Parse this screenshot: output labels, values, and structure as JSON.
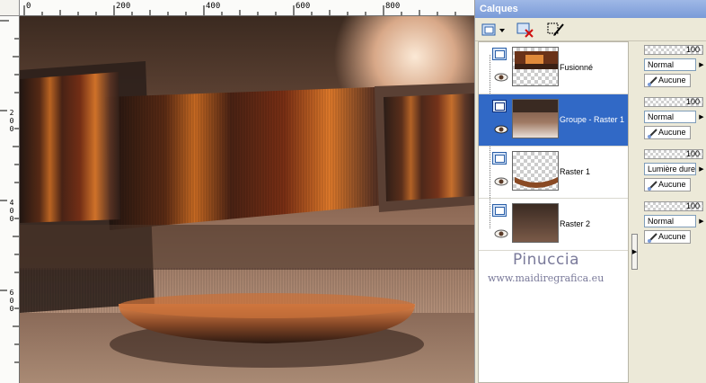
{
  "canvas": {
    "ruler_top_labels": [
      "0",
      "200",
      "400",
      "600",
      "800"
    ],
    "ruler_left_labels": [
      "2",
      "0",
      "0",
      "4",
      "0",
      "0",
      "6",
      "0",
      "0"
    ]
  },
  "layers_panel": {
    "title": "Calques",
    "layers": [
      {
        "name": "Fusionné",
        "selected": false,
        "opacity": "100",
        "blend_mode": "Normal",
        "mask": "Aucune"
      },
      {
        "name": "Groupe - Raster 1",
        "selected": true,
        "opacity": "100",
        "blend_mode": "Normal",
        "mask": "Aucune"
      },
      {
        "name": "Raster 1",
        "selected": false,
        "opacity": "100",
        "blend_mode": "Lumière dure",
        "mask": "Aucune"
      },
      {
        "name": "Raster 2",
        "selected": false,
        "opacity": "100",
        "blend_mode": "Normal",
        "mask": "Aucune"
      }
    ],
    "watermark": {
      "name": "Pinuccia",
      "url": "www.maidiregrafica.eu"
    }
  },
  "colors": {
    "title_bar": "#7a9bd8",
    "selection": "#3169c6",
    "panel_bg": "#ece9d8"
  }
}
